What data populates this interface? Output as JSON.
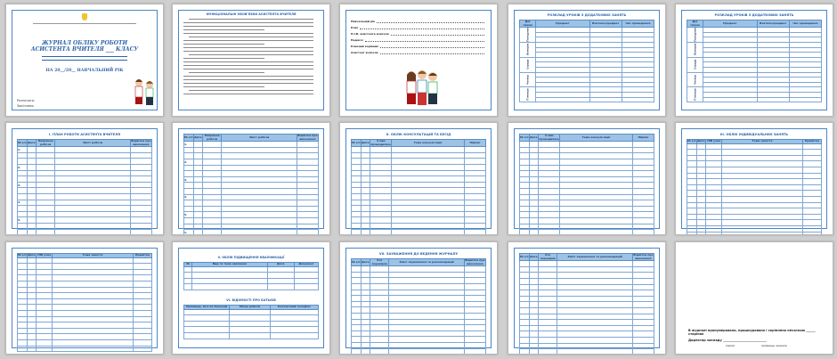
{
  "cover": {
    "title_line1": "ЖУРНАЛ ОБЛІКУ РОБОТИ",
    "title_line2": "АСИСТЕНТА ВЧИТЕЛЯ ___ КЛАСУ",
    "year": "НА 20__/20__ НАВЧАЛЬНИЙ РІК",
    "left_label1": "Розпочато:",
    "left_label2": "Закінчено:"
  },
  "p2": {
    "heading": "ФУНКЦІОНАЛЬНІ ОБОВ'ЯЗКИ АСИСТЕНТА ВЧИТЕЛЯ"
  },
  "p3": {
    "fields": [
      "Навчальний рік",
      "Клас",
      "П.І.Б. асистента вчителя",
      "Педагог",
      "Класний керівник",
      "Асистент вчителя"
    ]
  },
  "schedule": {
    "title": "РОЗКЛАД УРОКІВ З ДОДАТКОВИХ ЗАНЯТЬ",
    "col_day": "Дні тижня",
    "col_subject": "Предмет",
    "col_klass": "Клас",
    "col_teacher": "Вчитель/предмет",
    "col_time": "Час проведення",
    "days": [
      "Понеділок",
      "Вівторок",
      "Середа",
      "Четвер",
      "П'ятниця"
    ]
  },
  "plan": {
    "title": "І. ПЛАН РОБОТИ АСИСТЕНТА ВЧИТЕЛЯ",
    "col_n": "№ з/п",
    "col_date": "Дата",
    "col_dir": "Напрямок роботи",
    "col_content": "Зміст роботи",
    "col_note": "Відмітка про виконання",
    "section_labels": [
      "1.",
      "2.",
      "3.",
      "4.",
      "5."
    ]
  },
  "consult": {
    "title": "ІІ. ОБЛІК КОНСУЛЬТАЦІЙ ТА БЕСІД",
    "col_n": "№ з/п",
    "col_date": "Дата",
    "col_with": "З ким проводилась",
    "col_topic": "Тема консультації",
    "col_sign": "Підпис"
  },
  "individual": {
    "title": "ІІІ. ОБЛІК ІНДИВІДУАЛЬНИХ ЗАНЯТЬ",
    "col_n": "№ з/п",
    "col_date": "Дата",
    "col_pupil": "ПІБ учня",
    "col_topic": "Тема заняття",
    "col_note": "Примітка"
  },
  "attest": {
    "title1": "V. ОБЛІК ПІДВИЩЕННЯ КВАЛІФІКАЦІЇ",
    "col_a": "Вид та тема навчання",
    "col_b": "Дата",
    "col_c": "Документ",
    "title2": "VI. ВІДОМОСТІ ПРО БАТЬКІВ",
    "col_d": "Прізвище, ім'я по батькові",
    "col_e": "Місце роботи",
    "col_f": "Контактний телефон"
  },
  "remarks": {
    "title": "VII. ЗАУВАЖЕННЯ ДО ВЕДЕННЯ ЖУРНАЛУ",
    "col_n": "№ з/п",
    "col_date": "Дата",
    "col_who": "Хто перевіряв",
    "col_text": "Зміст зауваження та рекомендацій",
    "col_mark": "Відмітка про виконання"
  },
  "final": {
    "line1": "В журналі пронумеровано, прошнуровано і скріплено печаткою ______ сторінок",
    "line2": "Директор закладу ____________________________",
    "sub1": "підпис",
    "sub2": "прізвище, ініціали"
  }
}
